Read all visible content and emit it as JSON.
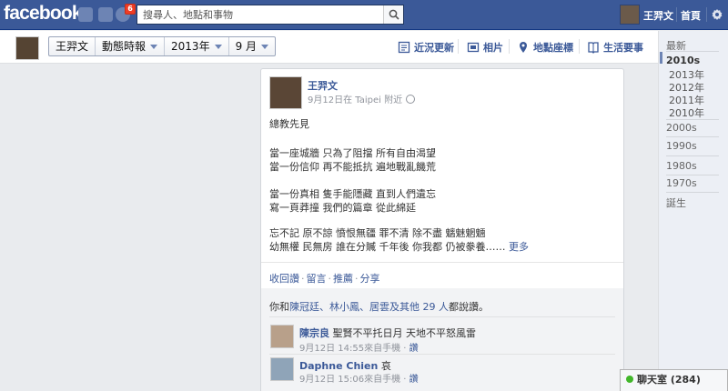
{
  "topbar": {
    "logo": "facebook",
    "notification_count": "6",
    "search_placeholder": "搜尋人、地點和事物",
    "user_name": "王羿文",
    "home_label": "首頁",
    "colors": {
      "bar": "#3b5998",
      "badge": "#f03d25"
    }
  },
  "timeline_nav": {
    "name": "王羿文",
    "section": "動態時報",
    "year": "2013年",
    "month": "9 月",
    "links": [
      {
        "label": "近況更新",
        "icon": "status-icon"
      },
      {
        "label": "相片",
        "icon": "photo-icon"
      },
      {
        "label": "地點座標",
        "icon": "place-pin-icon"
      },
      {
        "label": "生活要事",
        "icon": "life-event-icon"
      }
    ]
  },
  "rail": {
    "items": [
      "最新",
      "2010s",
      "2013年",
      "2012年",
      "2011年",
      "2010年",
      "2000s",
      "1990s",
      "1980s",
      "1970s",
      "誕生"
    ],
    "active": "2010s"
  },
  "story": {
    "author": "王羿文",
    "meta": "9月12日在 Taipei 附近",
    "lines": [
      "總教先見",
      "",
      "當一座城牆 只為了阻擋 所有自由渴望",
      "當一份信仰 再不能抵抗 遍地戰亂饑荒",
      "",
      "當一份真相 隻手能隱藏 直到人們遺忘",
      "寫一頁莽撞 我們的篇章 從此綿延",
      "",
      "忘不記 原不諒 憤恨無疆 罪不清 除不盡 魑魅魍魎",
      "幼無權 民無房 誰在分贓 千年後 你我都 仍被豢養……"
    ],
    "more_label": "更多",
    "actions": [
      "收回讚",
      "留言",
      "推薦",
      "分享"
    ],
    "likes": {
      "prefix": "你和",
      "names": "陳冠廷、林小鳳、居雲及其他 29 人",
      "suffix": "都說讚。"
    },
    "comments": [
      {
        "name": "陳宗良",
        "text": "聖賢不平托日月 天地不平怒風雷",
        "time": "9月12日 14:55來自手機",
        "like": "讚"
      },
      {
        "name": "Daphne Chien",
        "text": "哀",
        "time": "9月12日 15:06來自手機",
        "like": "讚"
      }
    ]
  },
  "chat": {
    "label": "聊天室 (284)"
  }
}
